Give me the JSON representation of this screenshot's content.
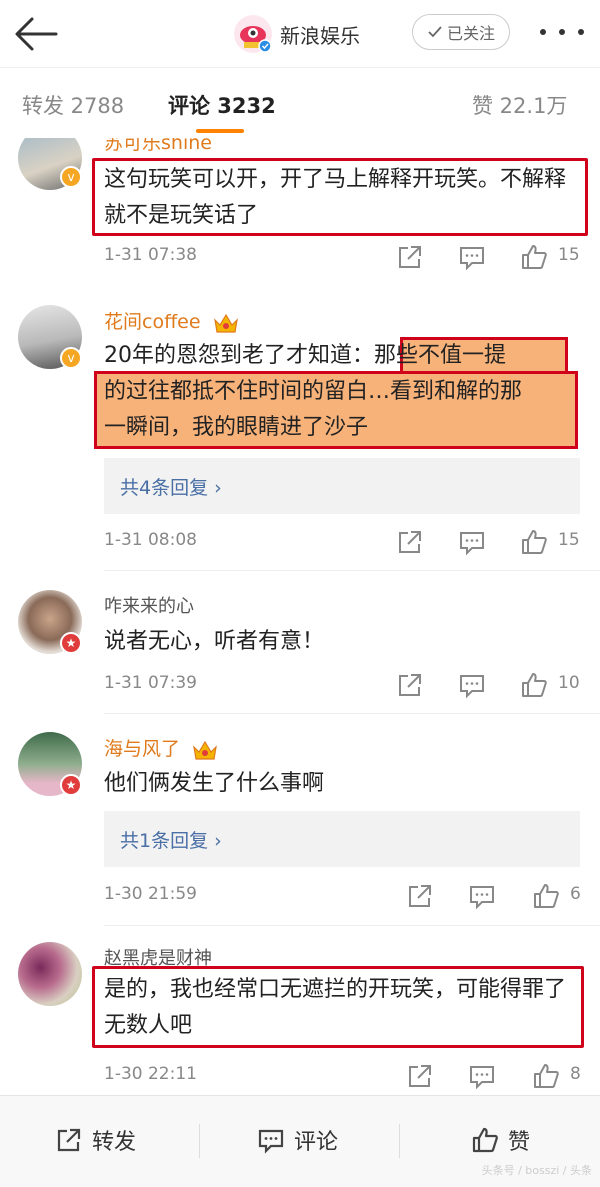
{
  "header": {
    "title": "新浪娱乐",
    "follow_label": "已关注"
  },
  "tabs": {
    "repost": "转发 2788",
    "comment": "评论 3232",
    "like": "赞 22.1万"
  },
  "comments": [
    {
      "username": "苏可乐shine",
      "text": "这句玩笑可以开，开了马上解释开玩笑。不解释就不是玩笑话了",
      "time": "1-31 07:38",
      "likes": "15"
    },
    {
      "username": "花间coffee",
      "text_prefix": "20年的恩怨到老了才知道：",
      "text_hl1": "那些不值一提",
      "text_hl2": "的过往都抵不住时间的留白…看到和解的那",
      "text_hl3": "一瞬间，我的眼睛进了沙子",
      "replies": "共4条回复 ›",
      "time": "1-31 08:08",
      "likes": "15"
    },
    {
      "username": "咋来来的心",
      "text": "说者无心，听者有意！",
      "time": "1-31 07:39",
      "likes": "10"
    },
    {
      "username": "海与风了",
      "text": "他们俩发生了什么事啊",
      "replies": "共1条回复 ›",
      "time": "1-30 21:59",
      "likes": "6"
    },
    {
      "username": "赵黑虎是财神",
      "text": "是的，我也经常口无遮拦的开玩笑，可能得罪了无数人吧",
      "time": "1-30 22:11",
      "likes": "8"
    }
  ],
  "bottom": {
    "repost": "转发",
    "comment": "评论",
    "like": "赞"
  },
  "watermark": "头条号 / bosszi / 头条"
}
